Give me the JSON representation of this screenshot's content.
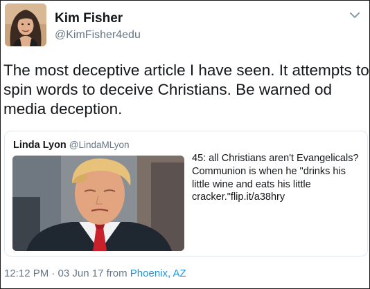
{
  "tweet": {
    "author": {
      "display_name": "Kim Fisher",
      "handle": "@KimFisher4edu",
      "avatar": "profile-photo"
    },
    "menu_icon": "chevron-down-icon",
    "text": "The most deceptive article I have seen. It attempts to spin words to deceive Christians.  Be warned od media deception.",
    "quoted_tweet": {
      "display_name": "Linda Lyon",
      "handle": "@LindaMLyon",
      "text": "45: all Christians aren't Evangelicals? Communion is when he \"drinks his little wine and eats his little cracker.\"flip.it/a38hry",
      "image": "photo-man-in-suit-red-tie"
    },
    "time": "12:12 PM · 03 Jun 17",
    "from_label": "from",
    "place": "Phoenix, AZ"
  },
  "colors": {
    "text": "#14171a",
    "secondary_text": "#657786",
    "link": "#1b95e0",
    "card_border": "#e1e8ed"
  }
}
